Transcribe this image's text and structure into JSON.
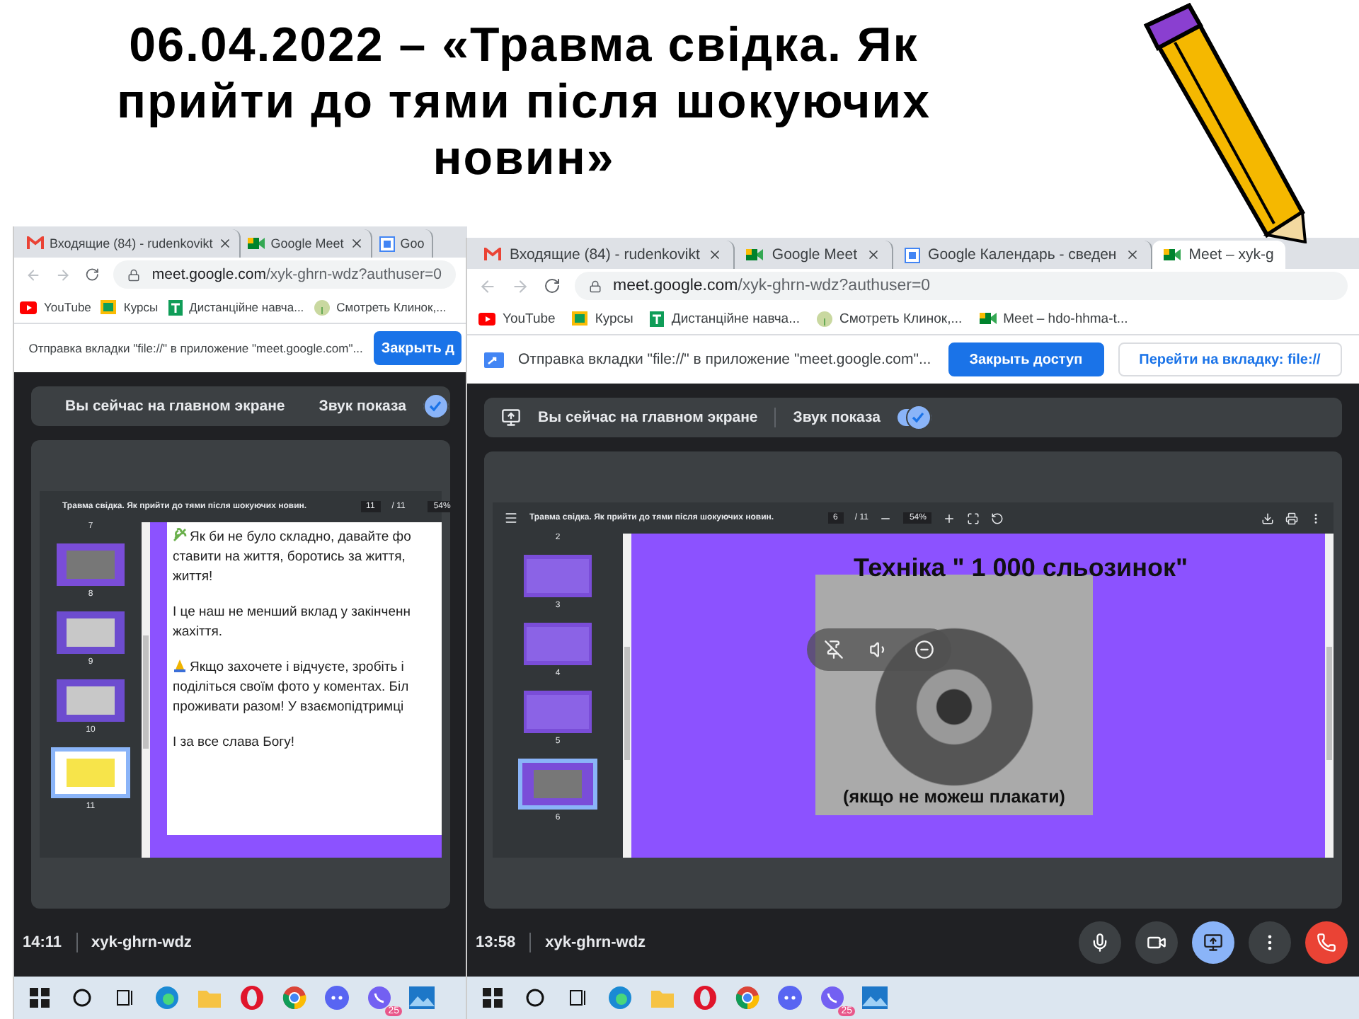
{
  "heading_lines": [
    "06.04.2022 – «Травма свідка. Як",
    "прийти до тями після шокуючих",
    "новин»"
  ],
  "screens": [
    {
      "tabs": [
        {
          "label": "Входящие (84) - rudenkovikt",
          "kind": "mail",
          "selected": false,
          "closable": true
        },
        {
          "label": "Google Meet",
          "kind": "meet",
          "selected": false,
          "closable": true
        },
        {
          "label": "Goo",
          "kind": "calendar",
          "selected": false,
          "closable": false
        }
      ],
      "url": {
        "host": "meet.google.com",
        "path": "/xyk-ghrn-wdz?authuser=0"
      },
      "bookmarks": [
        {
          "label": "YouTube",
          "kind": "youtube"
        },
        {
          "label": "Курсы",
          "kind": "classroom"
        },
        {
          "label": "Дистанційне навча...",
          "kind": "sheets"
        },
        {
          "label": "Смотреть Клинок,...",
          "kind": "tree"
        }
      ],
      "share_bar": {
        "message": "Отправка вкладки \"file://\" в приложение \"meet.google.com\"...",
        "buttons": [
          {
            "label": "Закрыть д",
            "kind": "primary"
          }
        ]
      },
      "banner": {
        "message": "Вы сейчас на главном экране",
        "sound_label": "Звук показа",
        "sound_on": true
      },
      "viewer": {
        "title": "Травма свідка. Як прийти до тями після шокуючих новин.",
        "page": "11",
        "total": "/ 11",
        "zoom": "54%",
        "full_toolbar": false,
        "first_label": "7",
        "thumbnails": [
          {
            "label": "8",
            "kind": "photo",
            "selected": false
          },
          {
            "label": "9",
            "kind": "text",
            "selected": false
          },
          {
            "label": "10",
            "kind": "text",
            "selected": false
          },
          {
            "label": "11",
            "kind": "sun",
            "selected": true
          }
        ],
        "slide": {
          "kind": "text",
          "paragraphs": [
            {
              "kind": "leaf",
              "lines": [
                "Як би не було складно, давайте фо",
                "ставити на життя, боротись за життя,",
                "життя!"
              ]
            },
            {
              "lines": [
                "І це наш не менший вклад у закінченн",
                "жахіття."
              ]
            },
            {
              "kind": "hands",
              "lines": [
                "Якщо захочете і відчуєте, зробіть і",
                "поділіться своїм фото у коментах. Біл",
                "проживати разом! У взаємопідтримці"
              ]
            },
            {
              "lines": [
                "І за все слава Богу!"
              ]
            }
          ]
        }
      },
      "call": {
        "time": "14:11",
        "code": "xyk-ghrn-wdz"
      },
      "taskbar": {
        "badge": "25"
      }
    },
    {
      "tabs": [
        {
          "label": "Входящие (84) - rudenkovikt",
          "kind": "mail",
          "selected": false,
          "closable": true
        },
        {
          "label": "Google Meet",
          "kind": "meet",
          "selected": false,
          "closable": true
        },
        {
          "label": "Google Календарь - сведен",
          "kind": "calendar",
          "selected": false,
          "closable": true
        },
        {
          "label": "Meet – xyk-g",
          "kind": "meet",
          "selected": true,
          "closable": false
        }
      ],
      "url": {
        "host": "meet.google.com",
        "path": "/xyk-ghrn-wdz?authuser=0"
      },
      "bookmarks": [
        {
          "label": "YouTube",
          "kind": "youtube"
        },
        {
          "label": "Курсы",
          "kind": "classroom"
        },
        {
          "label": "Дистанційне навча...",
          "kind": "sheets"
        },
        {
          "label": "Смотреть Клинок,...",
          "kind": "tree"
        },
        {
          "label": "Meet – hdo-hhma-t...",
          "kind": "meet"
        }
      ],
      "share_bar": {
        "message": "Отправка вкладки \"file://\" в приложение \"meet.google.com\"...",
        "buttons": [
          {
            "label": "Закрыть доступ",
            "kind": "primary"
          },
          {
            "label": "Перейти на вкладку: file://",
            "kind": "secondary"
          }
        ]
      },
      "banner": {
        "message": "Вы сейчас на главном экране",
        "sound_label": "Звук показа",
        "sound_on": true
      },
      "viewer": {
        "title": "Травма свідка. Як прийти до тями після шокуючих новин.",
        "page": "6",
        "total": "/ 11",
        "zoom": "54%",
        "full_toolbar": true,
        "first_label": "2",
        "thumbnails": [
          {
            "label": "3",
            "kind": "purple",
            "selected": false
          },
          {
            "label": "4",
            "kind": "purple",
            "selected": false
          },
          {
            "label": "5",
            "kind": "purple",
            "selected": false
          },
          {
            "label": "6",
            "kind": "photo",
            "selected": true
          }
        ],
        "slide": {
          "kind": "image",
          "title": "Техніка \" 1 000 сльозинок\"",
          "caption": "(якщо не можеш плакати)"
        }
      },
      "call": {
        "time": "13:58",
        "code": "xyk-ghrn-wdz",
        "controls": [
          {
            "kind": "mic",
            "selected": false
          },
          {
            "kind": "camera",
            "selected": false
          },
          {
            "kind": "present",
            "selected": true
          },
          {
            "kind": "more",
            "selected": false
          },
          {
            "kind": "end",
            "selected": false
          }
        ]
      },
      "taskbar": {
        "badge": "25"
      }
    }
  ]
}
